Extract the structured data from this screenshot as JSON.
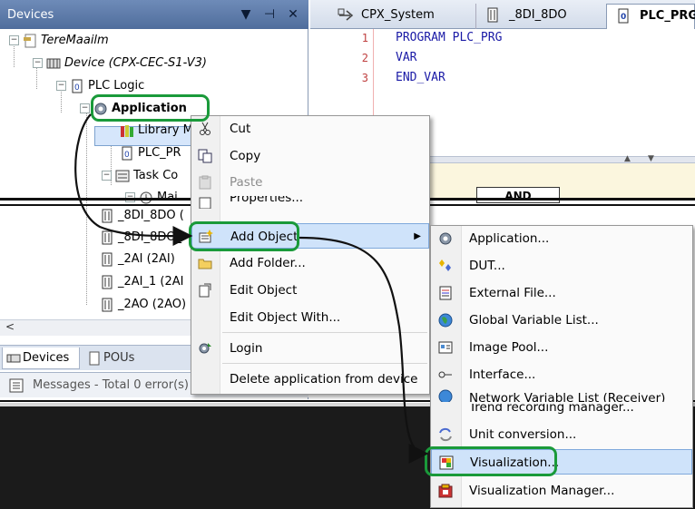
{
  "devices_panel": {
    "title": "Devices",
    "header_buttons": [
      "▼",
      "⊣",
      "✕"
    ],
    "tree": [
      {
        "label": "TereMaailm",
        "icon": "project-icon",
        "italic": true
      },
      {
        "label": "Device (CPX-CEC-S1-V3)",
        "icon": "device-icon",
        "italic": true
      },
      {
        "label": "PLC Logic",
        "icon": "plc-logic-icon"
      },
      {
        "label": "Application",
        "icon": "gear-icon",
        "bold": true
      },
      {
        "label": "Library M",
        "icon": "library-icon"
      },
      {
        "label": "PLC_PR",
        "icon": "pou-icon"
      },
      {
        "label": "Task Co",
        "icon": "task-config-icon"
      },
      {
        "label": "Mai",
        "icon": "task-icon"
      },
      {
        "label": "_8DI_8DO (",
        "icon": "io-module-icon"
      },
      {
        "label": "_8DI_8DO_",
        "icon": "io-module-icon"
      },
      {
        "label": "_2AI (2AI)",
        "icon": "io-module-icon"
      },
      {
        "label": "_2AI_1 (2AI",
        "icon": "io-module-icon"
      },
      {
        "label": "_2AO (2AO)",
        "icon": "io-module-icon"
      }
    ],
    "bottom_tabs": {
      "devices": "Devices",
      "pous": "POUs"
    },
    "messages": "Messages - Total 0 error(s)"
  },
  "editor": {
    "tabs": [
      "CPX_System",
      "_8DI_8DO",
      "PLC_PRG"
    ],
    "line_numbers": [
      "1",
      "2",
      "3"
    ],
    "code_lines": [
      "PROGRAM PLC_PRG",
      "VAR",
      "END_VAR"
    ],
    "fbd_block": "AND"
  },
  "context_menu": {
    "items": [
      {
        "label": "Cut",
        "icon": "scissors-icon"
      },
      {
        "label": "Copy",
        "icon": "copy-icon"
      },
      {
        "label": "Paste",
        "icon": "paste-icon",
        "disabled": true
      },
      {
        "label": "Properties...",
        "icon": "properties-icon"
      },
      {
        "label": "Add Object",
        "icon": "add-object-icon",
        "highlighted": true,
        "submenu": true
      },
      {
        "label": "Add Folder...",
        "icon": "folder-icon"
      },
      {
        "label": "Edit Object",
        "icon": "edit-object-icon"
      },
      {
        "label": "Edit Object With...",
        "icon": ""
      },
      {
        "label": "Login",
        "icon": "login-icon"
      },
      {
        "label": "Delete application from device",
        "icon": ""
      }
    ]
  },
  "add_object_submenu": {
    "items": [
      {
        "label": "Application...",
        "icon": "gear-icon"
      },
      {
        "label": "DUT...",
        "icon": "dut-icon"
      },
      {
        "label": "External File...",
        "icon": "external-file-icon"
      },
      {
        "label": "Global Variable List...",
        "icon": "globe-icon"
      },
      {
        "label": "Image Pool...",
        "icon": "image-pool-icon"
      },
      {
        "label": "Interface...",
        "icon": "interface-icon"
      },
      {
        "label": "Network Variable List (Receiver)",
        "icon": "network-icon"
      },
      {
        "label": "Trend recording manager...",
        "icon": ""
      },
      {
        "label": "Unit conversion...",
        "icon": "unit-conversion-icon"
      },
      {
        "label": "Visualization...",
        "icon": "visualization-icon",
        "highlighted": true
      },
      {
        "label": "Visualization Manager...",
        "icon": "visualization-manager-icon"
      }
    ]
  },
  "colors": {
    "callout": "#1a9a3a",
    "header": "#5a78a8",
    "highlight": "#cfe3fa",
    "code": "#1a1aa6",
    "line_numbers": "#c04040"
  }
}
